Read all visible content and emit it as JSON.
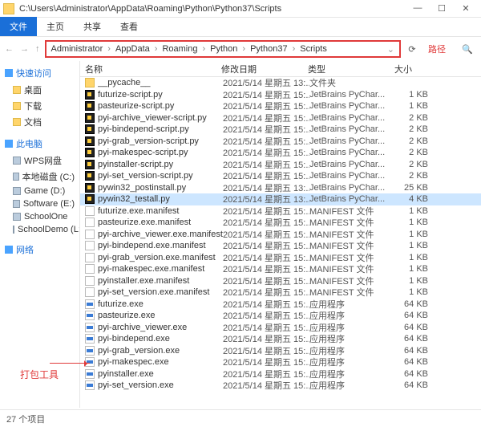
{
  "title_path": "C:\\Users\\Administrator\\AppData\\Roaming\\Python\\Python37\\Scripts",
  "ribbon": {
    "file": "文件",
    "home": "主页",
    "share": "共享",
    "view": "查看"
  },
  "breadcrumb": [
    "Administrator",
    "AppData",
    "Roaming",
    "Python",
    "Python37",
    "Scripts"
  ],
  "path_label": "路径",
  "side": {
    "quick": "快速访问",
    "quick_items": [
      "桌面",
      "下载",
      "文档"
    ],
    "thispc": "此电脑",
    "pc_items": [
      "WPS网盘",
      "本地磁盘 (C:)",
      "Game (D:)",
      "Software (E:)",
      "SchoolOne",
      "SchoolDemo (L:)"
    ],
    "network": "网络"
  },
  "cols": {
    "name": "名称",
    "date": "修改日期",
    "type": "类型",
    "size": "大小"
  },
  "rows": [
    {
      "ic": "folder",
      "n": "__pycache__",
      "d": "2021/5/14 星期五 13:...",
      "t": "文件夹",
      "s": ""
    },
    {
      "ic": "py",
      "n": "futurize-script.py",
      "d": "2021/5/14 星期五 15:...",
      "t": "JetBrains PyChar...",
      "s": "1 KB"
    },
    {
      "ic": "py",
      "n": "pasteurize-script.py",
      "d": "2021/5/14 星期五 15:...",
      "t": "JetBrains PyChar...",
      "s": "1 KB"
    },
    {
      "ic": "py",
      "n": "pyi-archive_viewer-script.py",
      "d": "2021/5/14 星期五 15:...",
      "t": "JetBrains PyChar...",
      "s": "2 KB"
    },
    {
      "ic": "py",
      "n": "pyi-bindepend-script.py",
      "d": "2021/5/14 星期五 15:...",
      "t": "JetBrains PyChar...",
      "s": "2 KB"
    },
    {
      "ic": "py",
      "n": "pyi-grab_version-script.py",
      "d": "2021/5/14 星期五 15:...",
      "t": "JetBrains PyChar...",
      "s": "2 KB"
    },
    {
      "ic": "py",
      "n": "pyi-makespec-script.py",
      "d": "2021/5/14 星期五 15:...",
      "t": "JetBrains PyChar...",
      "s": "2 KB"
    },
    {
      "ic": "py",
      "n": "pyinstaller-script.py",
      "d": "2021/5/14 星期五 15:...",
      "t": "JetBrains PyChar...",
      "s": "2 KB"
    },
    {
      "ic": "py",
      "n": "pyi-set_version-script.py",
      "d": "2021/5/14 星期五 15:...",
      "t": "JetBrains PyChar...",
      "s": "2 KB"
    },
    {
      "ic": "py",
      "n": "pywin32_postinstall.py",
      "d": "2021/5/14 星期五 13:...",
      "t": "JetBrains PyChar...",
      "s": "25 KB"
    },
    {
      "ic": "py",
      "n": "pywin32_testall.py",
      "d": "2021/5/14 星期五 13:...",
      "t": "JetBrains PyChar...",
      "s": "4 KB",
      "sel": true
    },
    {
      "ic": "txt",
      "n": "futurize.exe.manifest",
      "d": "2021/5/14 星期五 15:...",
      "t": "MANIFEST 文件",
      "s": "1 KB"
    },
    {
      "ic": "txt",
      "n": "pasteurize.exe.manifest",
      "d": "2021/5/14 星期五 15:...",
      "t": "MANIFEST 文件",
      "s": "1 KB"
    },
    {
      "ic": "txt",
      "n": "pyi-archive_viewer.exe.manifest",
      "d": "2021/5/14 星期五 15:...",
      "t": "MANIFEST 文件",
      "s": "1 KB"
    },
    {
      "ic": "txt",
      "n": "pyi-bindepend.exe.manifest",
      "d": "2021/5/14 星期五 15:...",
      "t": "MANIFEST 文件",
      "s": "1 KB"
    },
    {
      "ic": "txt",
      "n": "pyi-grab_version.exe.manifest",
      "d": "2021/5/14 星期五 15:...",
      "t": "MANIFEST 文件",
      "s": "1 KB"
    },
    {
      "ic": "txt",
      "n": "pyi-makespec.exe.manifest",
      "d": "2021/5/14 星期五 15:...",
      "t": "MANIFEST 文件",
      "s": "1 KB"
    },
    {
      "ic": "txt",
      "n": "pyinstaller.exe.manifest",
      "d": "2021/5/14 星期五 15:...",
      "t": "MANIFEST 文件",
      "s": "1 KB"
    },
    {
      "ic": "txt",
      "n": "pyi-set_version.exe.manifest",
      "d": "2021/5/14 星期五 15:...",
      "t": "MANIFEST 文件",
      "s": "1 KB"
    },
    {
      "ic": "exe",
      "n": "futurize.exe",
      "d": "2021/5/14 星期五 15:...",
      "t": "应用程序",
      "s": "64 KB"
    },
    {
      "ic": "exe",
      "n": "pasteurize.exe",
      "d": "2021/5/14 星期五 15:...",
      "t": "应用程序",
      "s": "64 KB"
    },
    {
      "ic": "exe",
      "n": "pyi-archive_viewer.exe",
      "d": "2021/5/14 星期五 15:...",
      "t": "应用程序",
      "s": "64 KB"
    },
    {
      "ic": "exe",
      "n": "pyi-bindepend.exe",
      "d": "2021/5/14 星期五 15:...",
      "t": "应用程序",
      "s": "64 KB"
    },
    {
      "ic": "exe",
      "n": "pyi-grab_version.exe",
      "d": "2021/5/14 星期五 15:...",
      "t": "应用程序",
      "s": "64 KB"
    },
    {
      "ic": "exe",
      "n": "pyi-makespec.exe",
      "d": "2021/5/14 星期五 15:...",
      "t": "应用程序",
      "s": "64 KB"
    },
    {
      "ic": "exe",
      "n": "pyinstaller.exe",
      "d": "2021/5/14 星期五 15:...",
      "t": "应用程序",
      "s": "64 KB"
    },
    {
      "ic": "exe",
      "n": "pyi-set_version.exe",
      "d": "2021/5/14 星期五 15:...",
      "t": "应用程序",
      "s": "64 KB"
    }
  ],
  "status": "27 个项目",
  "tool_label": "打包工具",
  "win": {
    "min": "—",
    "max": "☐",
    "close": "✕"
  }
}
